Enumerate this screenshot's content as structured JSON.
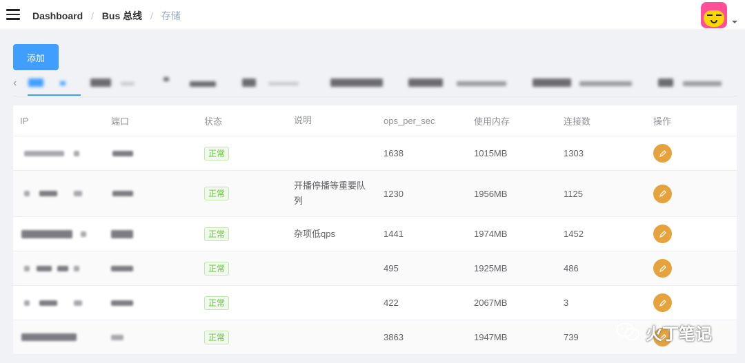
{
  "header": {
    "breadcrumb": [
      "Dashboard",
      "Bus 总线",
      "存储"
    ],
    "separator": "/"
  },
  "toolbar": {
    "add_label": "添加"
  },
  "tabs": {
    "prev_icon": "‹"
  },
  "table": {
    "headers": [
      "IP",
      "端口",
      "状态",
      "说明",
      "ops_per_sec",
      "使用内存",
      "连接数",
      "操作"
    ],
    "rows": [
      {
        "status": "正常",
        "desc": "",
        "ops": "1638",
        "mem": "1015MB",
        "conn": "1303"
      },
      {
        "status": "正常",
        "desc": "开播停播等重要队列",
        "ops": "1230",
        "mem": "1956MB",
        "conn": "1125"
      },
      {
        "status": "正常",
        "desc": "杂项低qps",
        "ops": "1441",
        "mem": "1974MB",
        "conn": "1452"
      },
      {
        "status": "正常",
        "desc": "",
        "ops": "495",
        "mem": "1925MB",
        "conn": "486"
      },
      {
        "status": "正常",
        "desc": "",
        "ops": "422",
        "mem": "2067MB",
        "conn": "3"
      },
      {
        "status": "正常",
        "desc": "",
        "ops": "3863",
        "mem": "1947MB",
        "conn": "739"
      }
    ]
  },
  "watermark": {
    "text": "火丁笔记"
  },
  "colors": {
    "primary": "#409eff",
    "success": "#67c23a",
    "warning": "#e6a23c"
  }
}
